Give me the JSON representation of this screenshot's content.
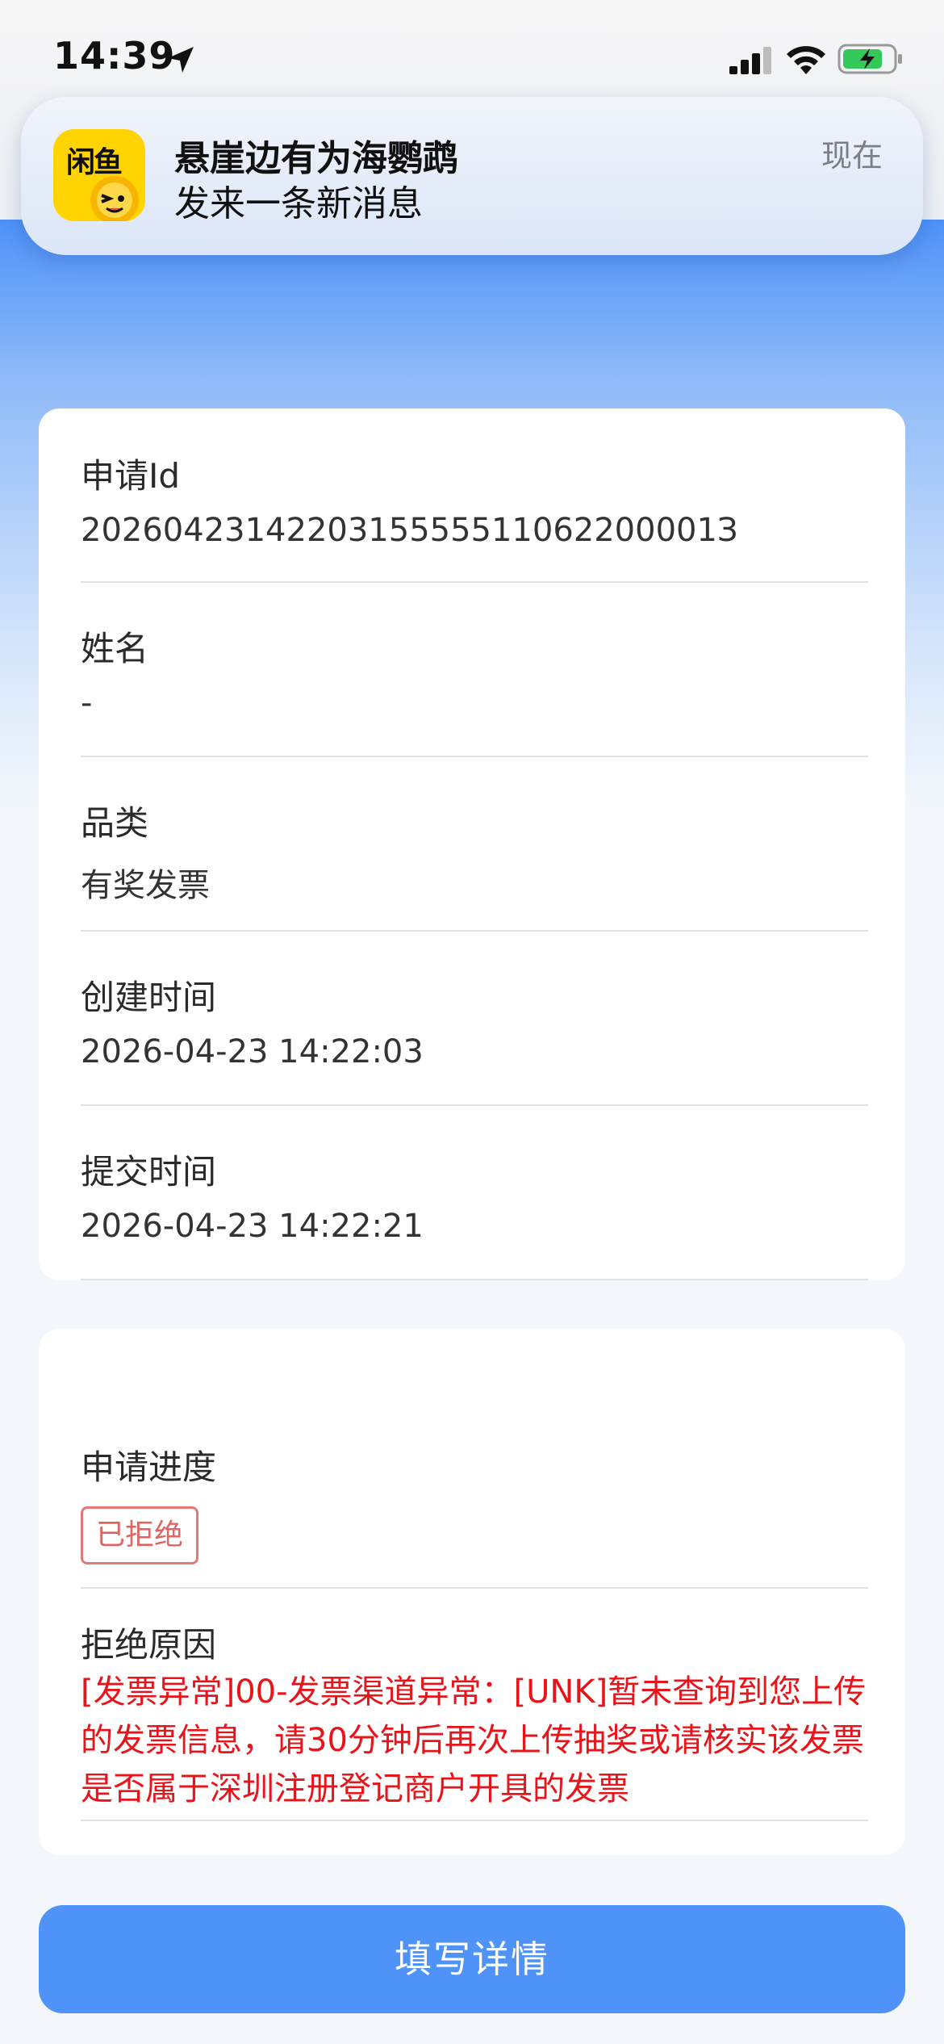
{
  "status_bar": {
    "time": "14:39",
    "icons": [
      "location-arrow-icon",
      "cellular-signal-icon",
      "wifi-icon",
      "battery-charging-icon"
    ]
  },
  "notification": {
    "app_icon_label": "闲鱼",
    "title": "悬崖边有为海鹦鹉",
    "body": "发来一条新消息",
    "time": "现在"
  },
  "info_card": {
    "fields": [
      {
        "label": "申请Id",
        "value": "2026042314220315555511062200001З"
      },
      {
        "label": "姓名",
        "value": "-"
      },
      {
        "label": "品类",
        "value": "有奖发票"
      },
      {
        "label": "创建时间",
        "value": "2026-04-23 14:22:03"
      },
      {
        "label": "提交时间",
        "value": "2026-04-23 14:22:21"
      }
    ]
  },
  "progress_card": {
    "progress_label": "申请进度",
    "status_tag": "已拒绝",
    "reason_label": "拒绝原因",
    "reason_text": "[发票异常]00-发票渠道异常：[UNK]暂未查询到您上传的发票信息，请30分钟后再次上传抽奖或请核实该发票是否属于深圳注册登记商户开具的发票"
  },
  "actions": {
    "fill_details_label": "填写详情"
  },
  "colors": {
    "brand_blue": "#4f92f8",
    "reject_red": "#e8141a",
    "tag_border": "#e47a78",
    "app_icon_yellow": "#ffd400"
  }
}
